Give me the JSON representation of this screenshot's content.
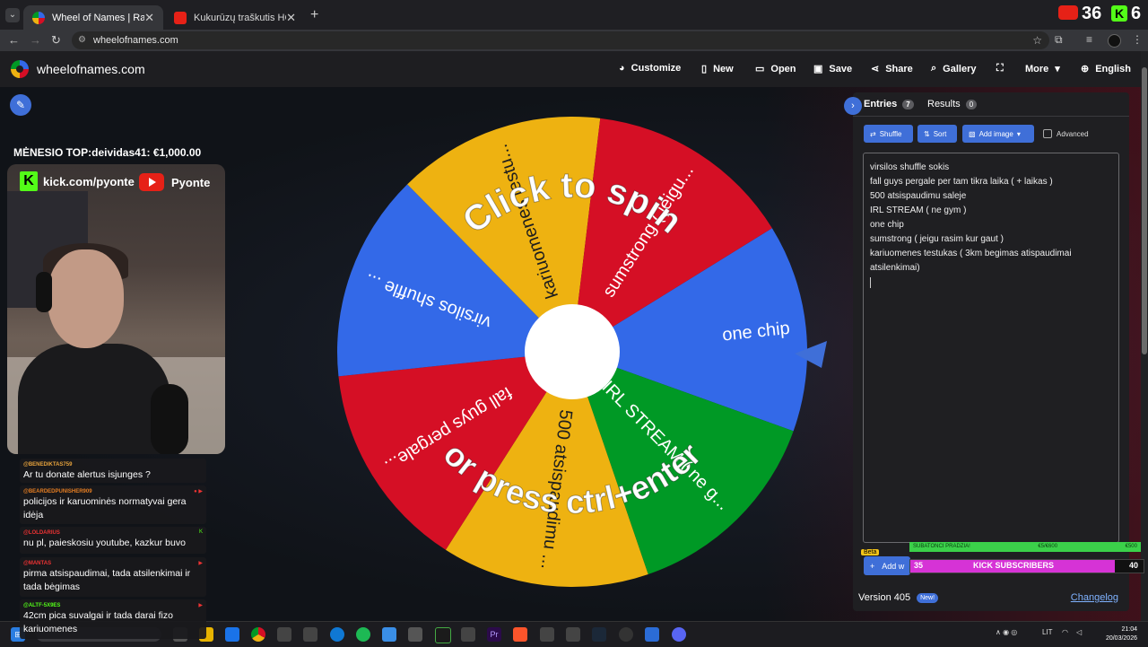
{
  "browser": {
    "tabs": [
      {
        "title": "Wheel of Names | Random nam",
        "active": true
      },
      {
        "title": "Kukurūzų traškutis HOT CHIP C",
        "active": false
      }
    ],
    "url": "wheelofnames.com"
  },
  "stream_overlay": {
    "top_count": "36",
    "kick_count": "6",
    "menesio_top": "MĖNESIO TOP:deividas41: €1,000.00",
    "kick_link": "kick.com/pyonte",
    "yt_name": "Pyonte",
    "chat": [
      {
        "user": "@BENEDIKTAS759",
        "text": "Ar tu donate alertus isjunges ?"
      },
      {
        "user": "@BEARDEDPUNISHER909",
        "text": "policijos ir karuominės normatyvai gera idėja"
      },
      {
        "user": "@LOLDARIUS",
        "text": "nu pl, paieskosiu youtube, kazkur buvo"
      },
      {
        "user": "@MANTAS",
        "text": "pirma atsispaudimai, tada atsilenkimai ir tada bėgimas"
      },
      {
        "user": "@ALTF-5X9ES",
        "text": "42cm pica suvalgai ir tada darai fizo kariuomenes"
      }
    ],
    "subatonic": {
      "label": "SUBATONCI PRADZIA!",
      "mid": "€5/€600",
      "right": "€500"
    },
    "kick_subscribers": {
      "label": "KICK SUBSCRIBERS",
      "current": "35",
      "goal": "40",
      "progress": 0.875
    }
  },
  "app": {
    "site_name": "wheelofnames.com",
    "menu": [
      "Customize",
      "New",
      "Open",
      "Save",
      "Share",
      "Gallery",
      "More",
      "English"
    ]
  },
  "wheel": {
    "prompt_line1": "Click to spin",
    "prompt_line2": "or press ctrl+enter",
    "slices": [
      {
        "label": "one chip",
        "color": "#3369e8"
      },
      {
        "label": "IRL STREAM ( ne g...",
        "color": "#009925"
      },
      {
        "label": "500 atsispaudimu ...",
        "color": "#eeb211"
      },
      {
        "label": "fall guys pergale...",
        "color": "#d50f25"
      },
      {
        "label": "virsilos shuffle ...",
        "color": "#3369e8"
      },
      {
        "label": "kariuomenes testu...",
        "color": "#eeb211"
      },
      {
        "label": "sumstrong ( jeigu...",
        "color": "#d50f25"
      }
    ]
  },
  "panel": {
    "entries_tab": "Entries",
    "entries_count": "7",
    "results_tab": "Results",
    "results_count": "0",
    "shuffle": "Shuffle",
    "sort": "Sort",
    "add_image": "Add image",
    "advanced": "Advanced",
    "entries": [
      "virsilos shuffle sokis",
      "fall guys pergale per tam tikra laika ( + laikas )",
      "500 atsispaudimu saleje",
      "IRL STREAM ( ne gym )",
      "one chip",
      "sumstrong ( jeigu rasim kur gaut )",
      "kariuomenes testukas ( 3km begimas atispaudimai atsilenkimai)"
    ],
    "beta": "Beta",
    "add_wheel": "Add w",
    "version": "Version 405",
    "new_badge": "New!",
    "changelog": "Changelog"
  },
  "taskbar": {
    "tray_lang": "LIT",
    "time": "21:04",
    "date": "20/03/2026"
  }
}
